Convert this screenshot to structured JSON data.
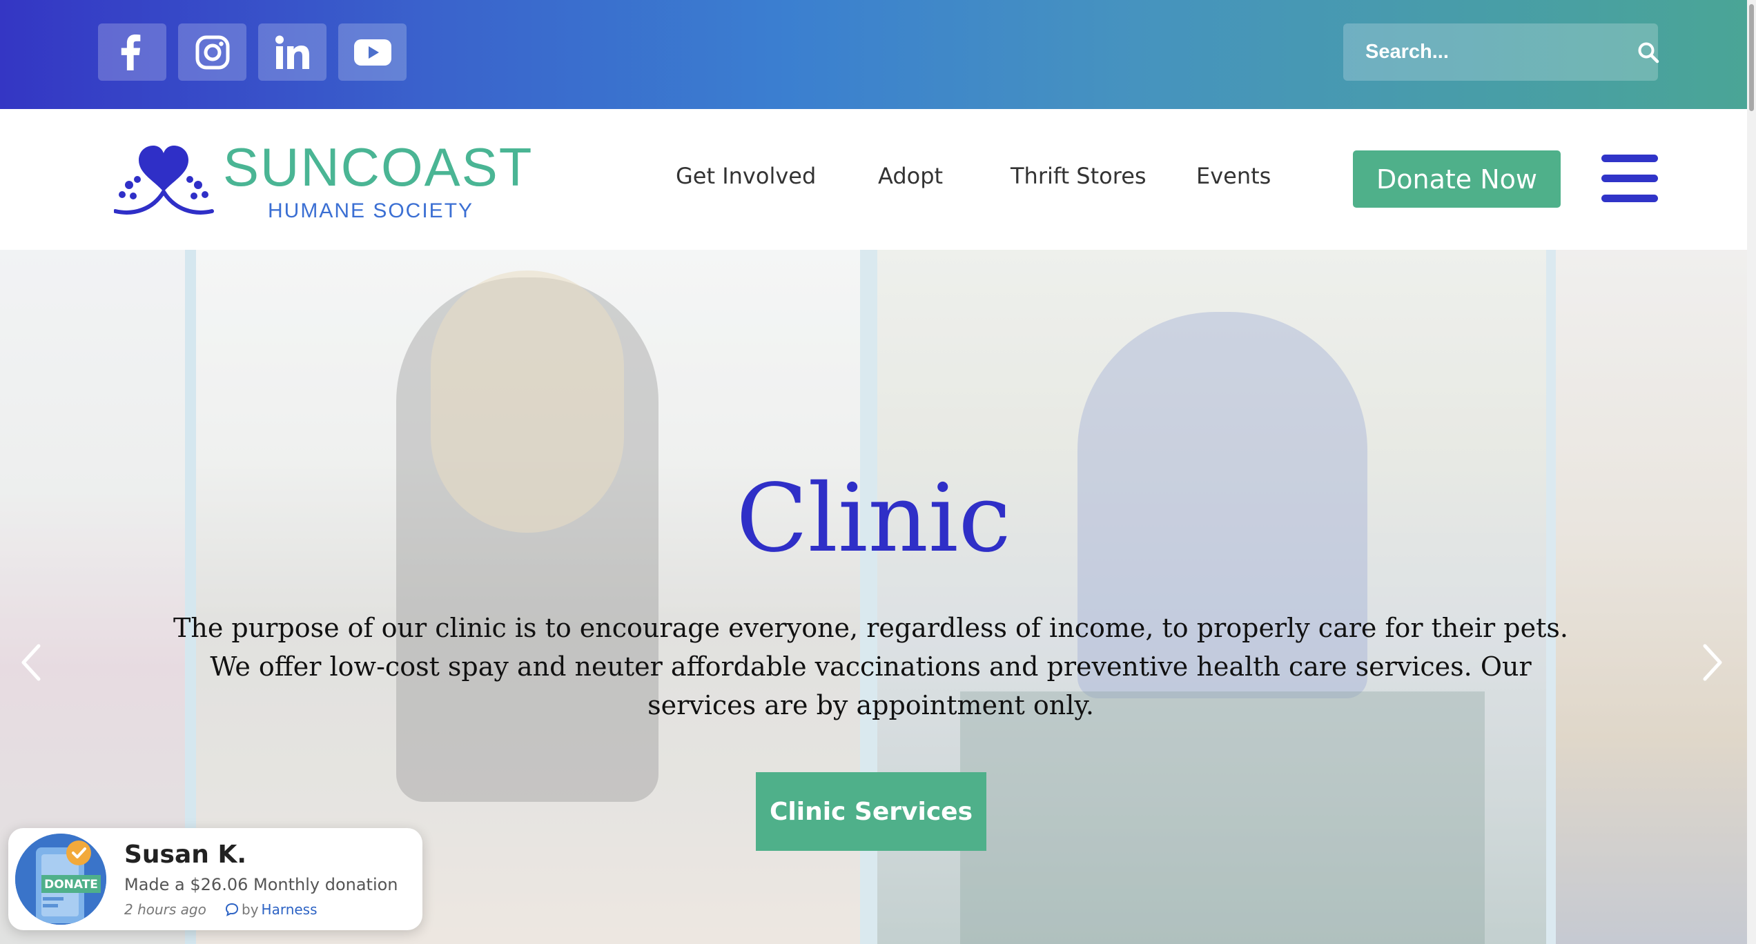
{
  "topbar": {
    "social": [
      {
        "name": "facebook-icon"
      },
      {
        "name": "instagram-icon"
      },
      {
        "name": "linkedin-icon"
      },
      {
        "name": "youtube-icon"
      }
    ],
    "search": {
      "placeholder": "Search...",
      "icon": "search-icon"
    },
    "colors": {
      "gradient_start": "#3436c4",
      "gradient_end": "#4aa596"
    }
  },
  "header": {
    "logo": {
      "word": "SUNCOAST",
      "sub": "HUMANE SOCIETY",
      "icon": "heart-paws-icon"
    },
    "nav": [
      "Get Involved",
      "Adopt",
      "Thrift Stores",
      "Events"
    ],
    "donate_label": "Donate Now",
    "menu_icon": "hamburger-menu-icon",
    "colors": {
      "accent_green": "#4fb08a",
      "brand_blue": "#3034c8"
    }
  },
  "hero": {
    "title": "Clinic",
    "text": "The purpose of our clinic is to encourage everyone, regardless of income, to properly care for their pets. We offer low-cost spay and neuter affordable vaccinations and preventive health care services. Our services are by appointment only.",
    "button_label": "Clinic Services",
    "prev_icon": "chevron-left-icon",
    "next_icon": "chevron-right-icon"
  },
  "toast": {
    "badge": "DONATE",
    "name": "Susan K.",
    "message": "Made a $26.06 Monthly donation",
    "time": "2 hours ago",
    "by_prefix": "by",
    "by_brand": "Harness"
  }
}
